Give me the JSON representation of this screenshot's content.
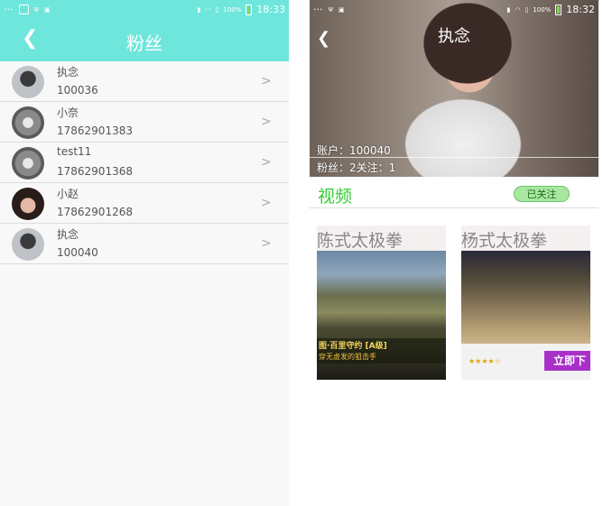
{
  "left": {
    "status": {
      "dots": "···",
      "time": "18:33",
      "battery": "100%"
    },
    "title": "粉丝",
    "back_icon": "chevron-left-icon",
    "fans": [
      {
        "name": "执念",
        "id": "100036"
      },
      {
        "name": "小奈",
        "id": "17862901383"
      },
      {
        "name": "test11",
        "id": "17862901368"
      },
      {
        "name": "小赵",
        "id": "17862901268"
      },
      {
        "name": "执念",
        "id": "100040"
      }
    ],
    "chevron": ">"
  },
  "right": {
    "status": {
      "dots": "···",
      "time": "18:32",
      "battery": "100%"
    },
    "title": "执念",
    "account": "账户：100040",
    "stats": "粉丝：2关注：1",
    "section_title": "视频",
    "follow_button": "已关注",
    "videos": [
      {
        "title": "陈式太极拳",
        "caption1": "图·百里守约 [A级]",
        "caption2": "穿无虚发的狙击手"
      },
      {
        "title": "杨式太极拳",
        "cta": "立即下",
        "rating": "★★★★☆"
      }
    ]
  },
  "colors": {
    "accent": "#6fe6dc",
    "green": "#33cc33",
    "follow_bg": "#a9e7a1"
  }
}
